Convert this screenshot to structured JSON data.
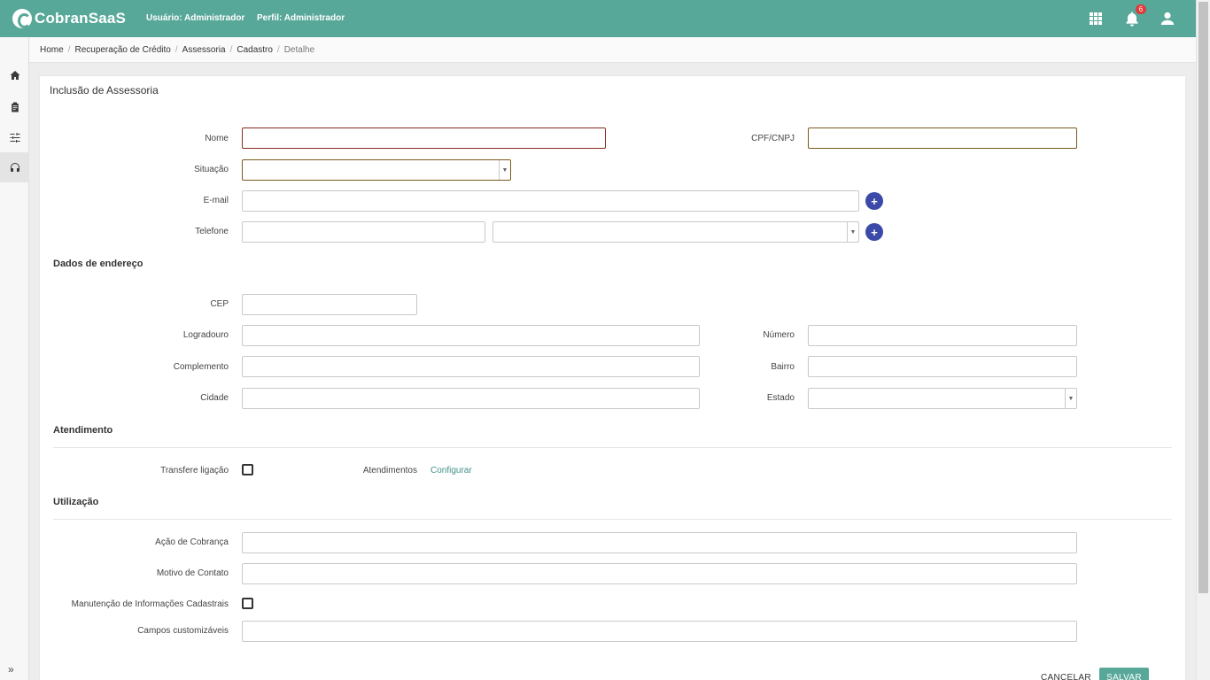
{
  "topbar": {
    "logo": "CobranSaaS",
    "user_label": "Usuário:",
    "user_value": "Administrador",
    "profile_label": "Perfil:",
    "profile_value": "Administrador",
    "notifications_count": "6",
    "icons": [
      "apps-grid-icon",
      "bell-icon",
      "user-icon"
    ]
  },
  "sidebar": {
    "items": [
      {
        "name": "home",
        "icon": "home-icon"
      },
      {
        "name": "clipboard",
        "icon": "clipboard-icon"
      },
      {
        "name": "settings",
        "icon": "sliders-icon"
      },
      {
        "name": "support",
        "icon": "headset-icon",
        "active": true
      }
    ],
    "expand_label": "»"
  },
  "breadcrumb": [
    "Home",
    "Recuperação de Crédito",
    "Assessoria",
    "Cadastro",
    "Detalhe"
  ],
  "form": {
    "title": "Inclusão de Assessoria",
    "labels": {
      "nome": "Nome",
      "cpf": "CPF/CNPJ",
      "situacao": "Situação",
      "email": "E-mail",
      "telefone": "Telefone",
      "cep": "CEP",
      "logradouro": "Logradouro",
      "numero": "Número",
      "complemento": "Complemento",
      "bairro": "Bairro",
      "cidade": "Cidade",
      "estado": "Estado",
      "transfere": "Transfere ligação",
      "atendimentos": "Atendimentos",
      "acao": "Ação de Cobrança",
      "motivo": "Motivo de Contato",
      "manutencao": "Manutenção de Informações Cadastrais",
      "campos": "Campos customizáveis"
    },
    "sections": {
      "endereco": "Dados de endereço",
      "atendimento": "Atendimento",
      "utilizacao": "Utilização"
    },
    "configurar_link": "Configurar",
    "add_symbol": "+",
    "select_arrow": "▼",
    "buttons": {
      "cancel": "CANCELAR",
      "save": "SALVAR"
    }
  },
  "colors": {
    "brand": "#58a899",
    "add_button": "#3b4aa8",
    "badge": "#e03a3a",
    "link": "#3f8f88"
  }
}
